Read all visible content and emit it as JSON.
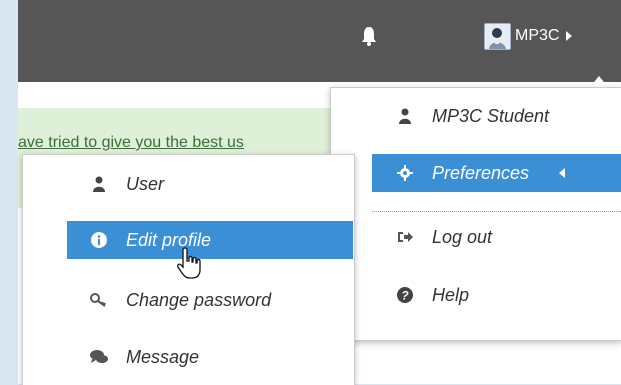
{
  "navbar": {
    "user_name": "MP3C"
  },
  "alert": {
    "text": "ave tried to give you the best us"
  },
  "user_menu": {
    "items": [
      {
        "label": "MP3C Student",
        "icon": "user-icon"
      },
      {
        "label": "Preferences",
        "icon": "gear-icon"
      },
      {
        "label": "Log out",
        "icon": "sign-out-icon"
      },
      {
        "label": "Help",
        "icon": "question-circle-icon"
      }
    ]
  },
  "preferences_menu": {
    "items": [
      {
        "label": "User",
        "icon": "user-icon"
      },
      {
        "label": "Edit profile",
        "icon": "info-circle-icon"
      },
      {
        "label": "Change password",
        "icon": "key-icon"
      },
      {
        "label": "Message",
        "icon": "comments-icon"
      }
    ]
  },
  "colors": {
    "navbar": "#565656",
    "active": "#3a8fd5",
    "alert_bg": "#dff0d8"
  }
}
